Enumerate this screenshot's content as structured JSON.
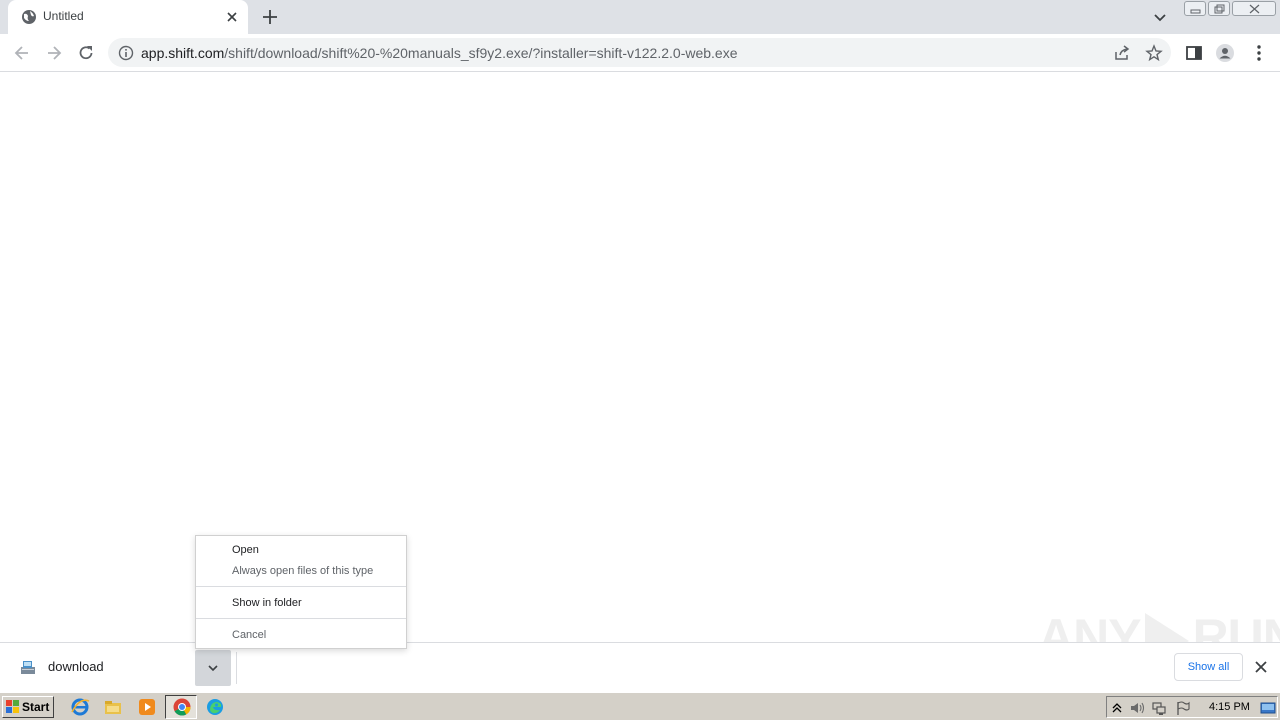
{
  "browser": {
    "tab": {
      "title": "Untitled"
    },
    "url": {
      "host": "app.shift.com",
      "path": "/shift/download/shift%20-%20manuals_sf9y2.exe/?installer=shift-v122.2.0-web.exe"
    }
  },
  "context_menu": {
    "items": [
      {
        "label": "Open"
      },
      {
        "label": "Always open files of this type"
      },
      {
        "label": "Show in folder"
      },
      {
        "label": "Cancel"
      }
    ]
  },
  "download_shelf": {
    "file_name": "download",
    "show_all_label": "Show all"
  },
  "watermark": {
    "left": "ANY",
    "right": "RUN"
  },
  "taskbar": {
    "start_label": "Start",
    "clock": "4:15 PM",
    "apps": [
      "ie-icon",
      "explorer-icon",
      "media-player-icon",
      "chrome-icon",
      "edge-icon"
    ]
  },
  "colors": {
    "tabstrip": "#dee1e6",
    "omnibox": "#f1f3f4",
    "link": "#1a73e8",
    "taskbar": "#d4d0c8"
  }
}
